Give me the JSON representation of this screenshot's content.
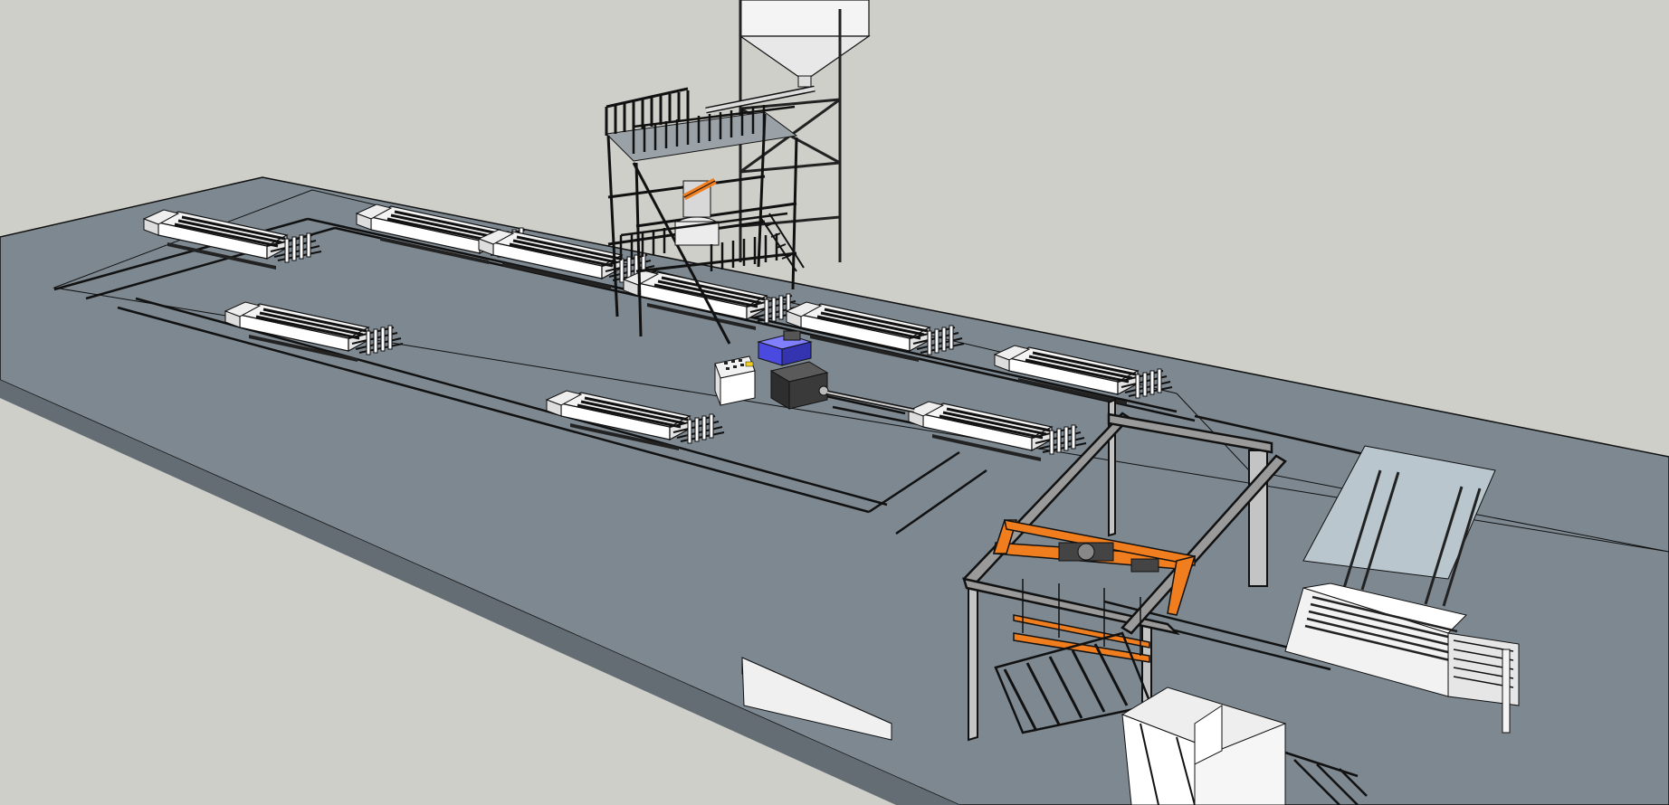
{
  "scene": {
    "background": "#cfcfca",
    "floor_color": "#7d8890",
    "floor_side_color": "#646d74",
    "pit_color": "#b9c6cd",
    "highlight_orange": "#f07d1e",
    "highlight_blue": "#4a4ae0",
    "machine_dark": "#3a3a3a",
    "objects": [
      "factory-floor",
      "mold-cart",
      "rail-track",
      "batching-tower",
      "silo",
      "control-panel",
      "hydraulic-pump",
      "transfer-cart",
      "gantry-crane",
      "stacking-rack"
    ]
  }
}
